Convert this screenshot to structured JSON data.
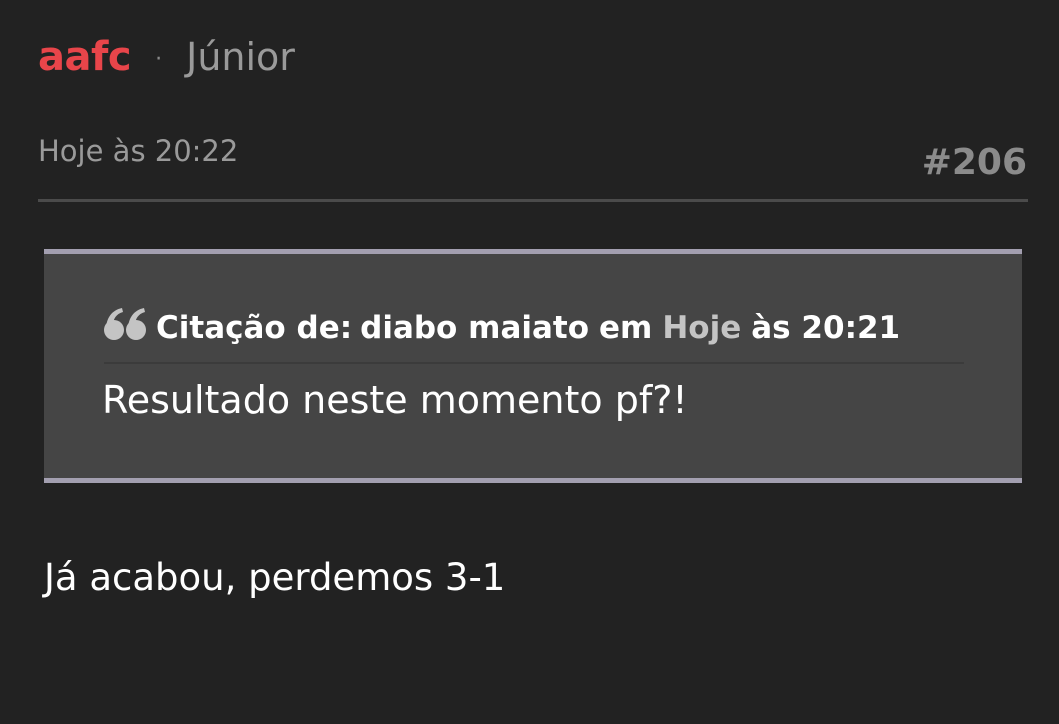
{
  "post": {
    "author": "aafc",
    "separator": "·",
    "rank": "Júnior",
    "date": "Hoje às 20:22",
    "number": "#206",
    "quote": {
      "prefix": "Citação de:",
      "author": "diabo maiato",
      "em": "em",
      "date_link": "Hoje",
      "time": "às 20:21",
      "text": "Resultado neste momento pf?!"
    },
    "body": "Já acabou, perdemos 3-1"
  },
  "colors": {
    "background": "#222222",
    "author": "#e8454a",
    "quote_background": "#454545",
    "quote_border": "#a39fb0"
  },
  "icons": {
    "quote": "quote-icon"
  }
}
